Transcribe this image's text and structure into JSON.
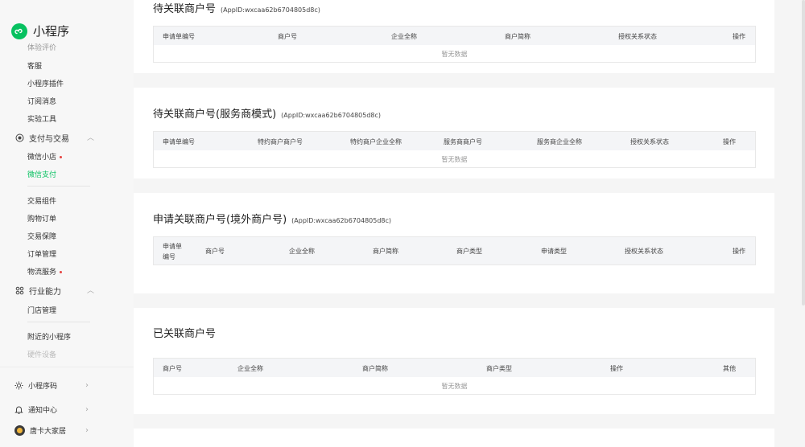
{
  "app": {
    "title": "小程序"
  },
  "sidebar": {
    "top_cut_item": "体验评价",
    "items_top": [
      "客服",
      "小程序插件",
      "订阅消息",
      "实验工具"
    ],
    "group_pay": {
      "label": "支付与交易",
      "items": [
        "微信小店",
        "微信支付"
      ]
    },
    "items_trade": [
      "交易组件",
      "购物订单",
      "交易保障",
      "订单管理",
      "物流服务"
    ],
    "group_industry": {
      "label": "行业能力",
      "items": [
        "门店管理"
      ]
    },
    "items_misc": [
      "附近的小程序",
      "硬件设备"
    ],
    "bottom": {
      "qrcode": "小程序码",
      "notify": "通知中心",
      "account": "唐卡大家居"
    }
  },
  "sections": {
    "s1": {
      "title": "待关联商户号",
      "appid": "(AppID:wxcaa62b6704805d8c)",
      "columns": [
        "申请单编号",
        "商户号",
        "企业全称",
        "商户简称",
        "授权关系状态",
        "操作"
      ],
      "empty": "暂无数据"
    },
    "s2": {
      "title": "待关联商户号(服务商模式)",
      "appid": "(AppID:wxcaa62b6704805d8c)",
      "columns": [
        "申请单编号",
        "特约商户商户号",
        "特约商户企业全称",
        "服务商商户号",
        "服务商企业全称",
        "授权关系状态",
        "操作"
      ],
      "empty": "暂无数据"
    },
    "s3": {
      "title": "申请关联商户号(境外商户号)",
      "appid": "(AppID:wxcaa62b6704805d8c)",
      "columns": [
        "申请单",
        "编号",
        "商户号",
        "企业全称",
        "商户简称",
        "商户类型",
        "申请类型",
        "授权关系状态",
        "操作"
      ]
    },
    "s4": {
      "title": "已关联商户号",
      "columns": [
        "商户号",
        "企业全称",
        "商户简称",
        "商户类型",
        "操作",
        "其他"
      ],
      "empty": "暂无数据"
    }
  }
}
